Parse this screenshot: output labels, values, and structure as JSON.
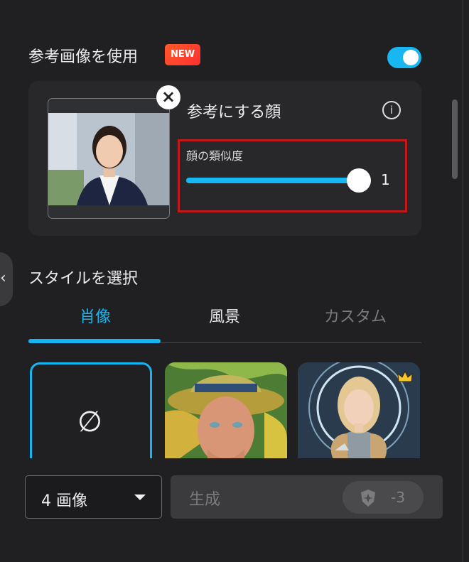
{
  "reference": {
    "title": "参考画像を使用",
    "badge": "NEW",
    "toggle_on": true,
    "remove_symbol": "×",
    "face_title": "参考にする顔",
    "info_symbol": "i",
    "similarity_label": "顔の類似度",
    "similarity_value": "1",
    "similarity_fraction": 1.0
  },
  "styles": {
    "title": "スタイルを選択",
    "tabs": [
      {
        "label": "肖像",
        "active": true
      },
      {
        "label": "風景",
        "active": false
      },
      {
        "label": "カスタム",
        "active": false
      }
    ],
    "none_symbol": "∅"
  },
  "bottom": {
    "count_label": "4 画像",
    "generate_label": "生成",
    "credit_cost": "-3"
  },
  "colors": {
    "accent": "#16b5f0",
    "highlight_box": "#c31818",
    "badge_red": "#ff3b2f"
  },
  "icons": [
    "close-icon",
    "info-icon",
    "chevron-left-icon",
    "dropdown-caret-icon",
    "credit-shield-icon",
    "crown-icon"
  ]
}
